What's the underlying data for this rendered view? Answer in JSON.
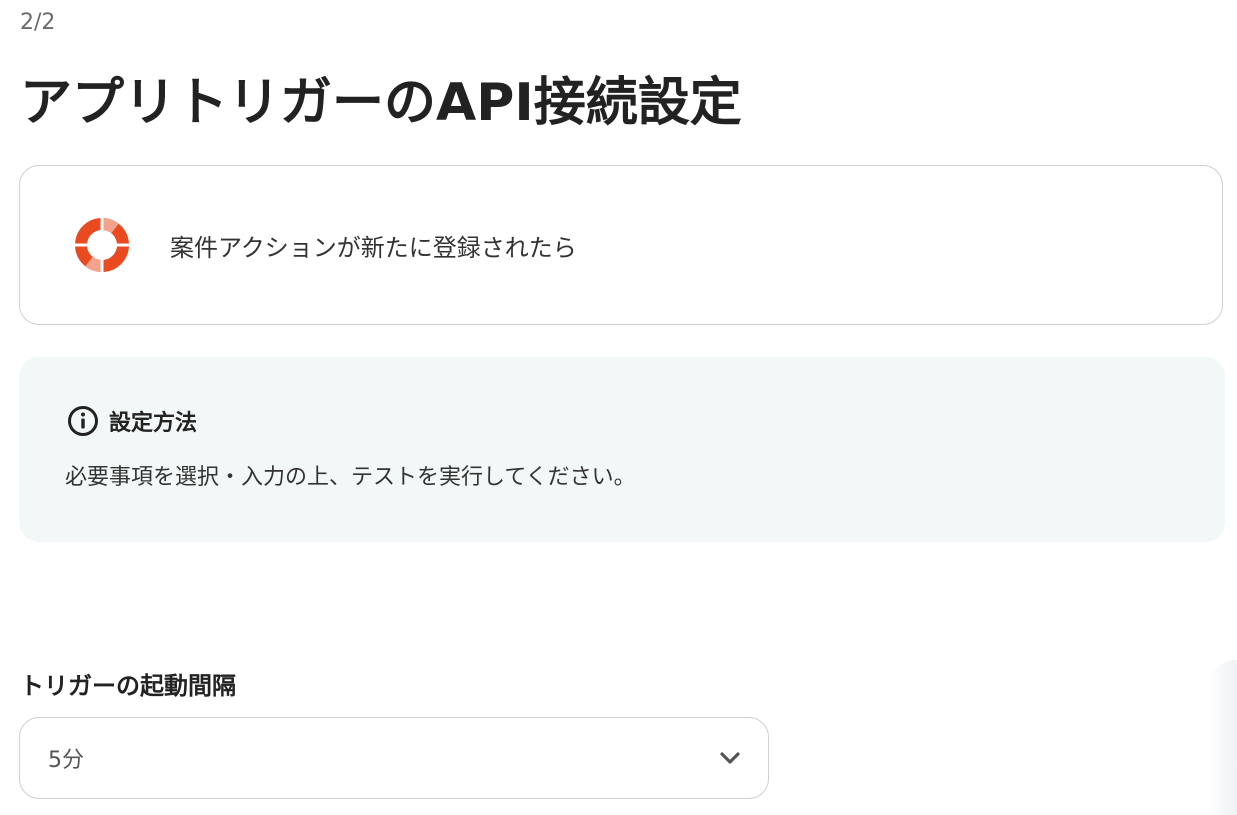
{
  "step": "2/2",
  "title": "アプリトリガーのAPI接続設定",
  "trigger_card": {
    "app_icon": "lifebuoy-logo-icon",
    "label": "案件アクションが新たに登録されたら"
  },
  "info": {
    "icon": "info-circle-icon",
    "title": "設定方法",
    "text": "必要事項を選択・入力の上、テストを実行してください。"
  },
  "interval_field": {
    "label": "トリガーの起動間隔",
    "selected": "5分",
    "icon": "chevron-down-icon"
  },
  "colors": {
    "logo_primary": "#ea4a1f",
    "logo_secondary": "#f3a28b",
    "info_background": "#f1f8f7",
    "border": "#cfcfcf"
  }
}
